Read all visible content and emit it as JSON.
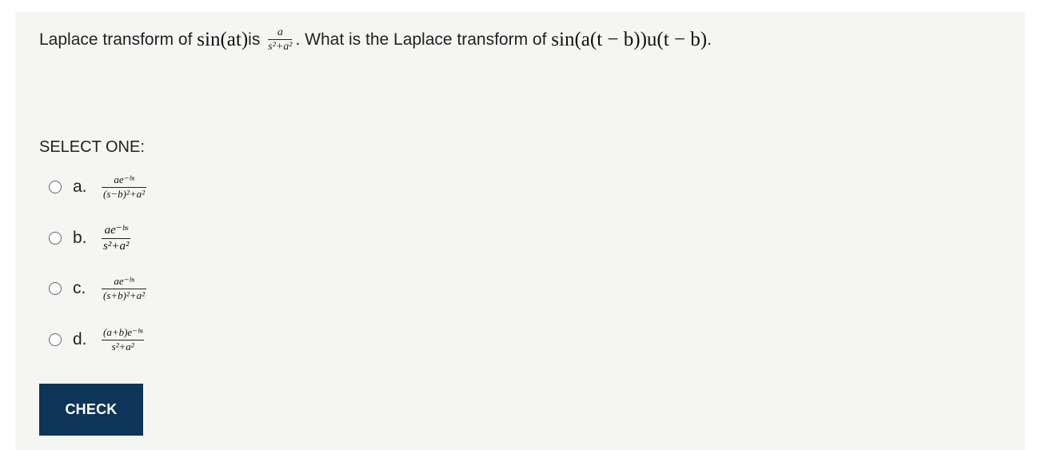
{
  "question": {
    "prefix": "Laplace transform of ",
    "sin_at": "sin(at)",
    "is": " is ",
    "frac_num": "a",
    "frac_den": "s²+a²",
    "middle": ". What is the Laplace transform of ",
    "target": "sin(a(t − b))u(t − b)",
    "suffix": "."
  },
  "select_label": "SELECT ONE:",
  "options": [
    {
      "letter": "a.",
      "num": "ae⁻ᵇˢ",
      "den": "(s−b)²+a²"
    },
    {
      "letter": "b.",
      "num": "ae⁻ᵇˢ",
      "den": "s²+a²"
    },
    {
      "letter": "c.",
      "num": "ae⁻ᵇˢ",
      "den": "(s+b)²+a²"
    },
    {
      "letter": "d.",
      "num": "(a+b)e⁻ᵇˢ",
      "den": "s²+a²"
    }
  ],
  "check_label": "CHECK"
}
